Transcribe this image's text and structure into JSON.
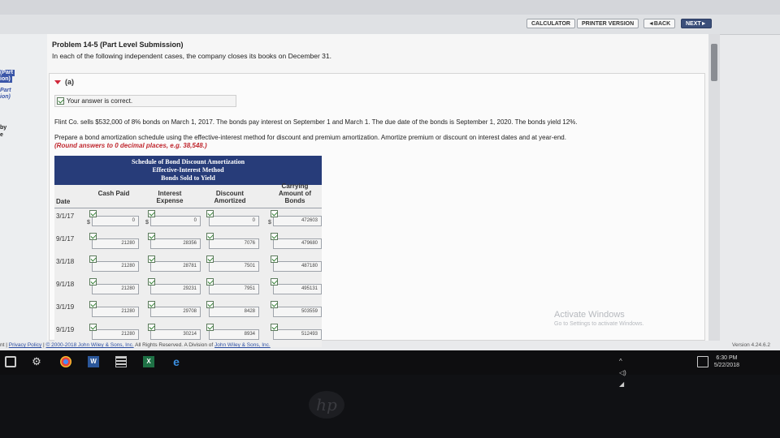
{
  "nav": {
    "calculator": "CALCULATOR",
    "printer_version": "PRINTER VERSION",
    "back": "◄BACK",
    "next": "NEXT►"
  },
  "sidebar": {
    "items": [
      {
        "label": "(Part"
      },
      {
        "label": "ion)"
      },
      {
        "label": "Part"
      },
      {
        "label": "ion)"
      },
      {
        "label": "by"
      },
      {
        "label": "e"
      }
    ]
  },
  "problem": {
    "title": "Problem 14-5 (Part Level Submission)",
    "description": "In each of the following independent cases, the company closes its books on December 31."
  },
  "part": {
    "label": "(a)",
    "status": "Your answer is correct.",
    "question": "Flint Co. sells $532,000 of 8% bonds on March 1, 2017. The bonds pay interest on September 1 and March 1. The due date of the bonds is September 1, 2020. The bonds yield 12%.",
    "instructions": "Prepare a bond amortization schedule using the effective-interest method for discount and premium amortization. Amortize premium or discount on interest dates and at year-end.",
    "rounding_note": "(Round answers to 0 decimal places, e.g. 38,548.)"
  },
  "schedule": {
    "title_lines": [
      "Schedule of Bond Discount Amortization",
      "Effective-Interest Method",
      "Bonds Sold to Yield"
    ],
    "headers": {
      "date": "Date",
      "cash_paid": "Cash Paid",
      "interest_expense": "Interest Expense",
      "discount_amortized": "Discount Amortized",
      "carrying_amount": "Carrying Amount of Bonds"
    },
    "currency_symbol": "$",
    "rows": [
      {
        "date": "3/1/17",
        "cash": "",
        "interest": "",
        "discount": "",
        "carrying": "472603"
      },
      {
        "date": "9/1/17",
        "cash": "21280",
        "interest": "28356",
        "discount": "7076",
        "carrying": "479680"
      },
      {
        "date": "3/1/18",
        "cash": "21280",
        "interest": "28781",
        "discount": "7501",
        "carrying": "487180"
      },
      {
        "date": "9/1/18",
        "cash": "21280",
        "interest": "29231",
        "discount": "7951",
        "carrying": "495131"
      },
      {
        "date": "3/1/19",
        "cash": "21280",
        "interest": "29708",
        "discount": "8428",
        "carrying": "503559"
      },
      {
        "date": "9/1/19",
        "cash": "21280",
        "interest": "30214",
        "discount": "8934",
        "carrying": "512493"
      }
    ]
  },
  "footer": {
    "left_fragment": "nt",
    "privacy": "Privacy Policy",
    "copyright": "© 2000-2018 John Wiley & Sons, Inc.",
    "rights": "All Rights Reserved. A Division of",
    "company": "John Wiley & Sons, Inc.",
    "version": "Version 4.24.6.2"
  },
  "watermark": {
    "line1": "Activate Windows",
    "line2": "Go to Settings to activate Windows."
  },
  "taskbar": {
    "time": "6:30 PM",
    "date": "5/22/2018"
  },
  "device_logo": "hp",
  "colors": {
    "header_blue": "#273c79",
    "accent_red": "#c0282f",
    "next_button": "#3b4f7a",
    "link_blue": "#2d4fa3"
  }
}
